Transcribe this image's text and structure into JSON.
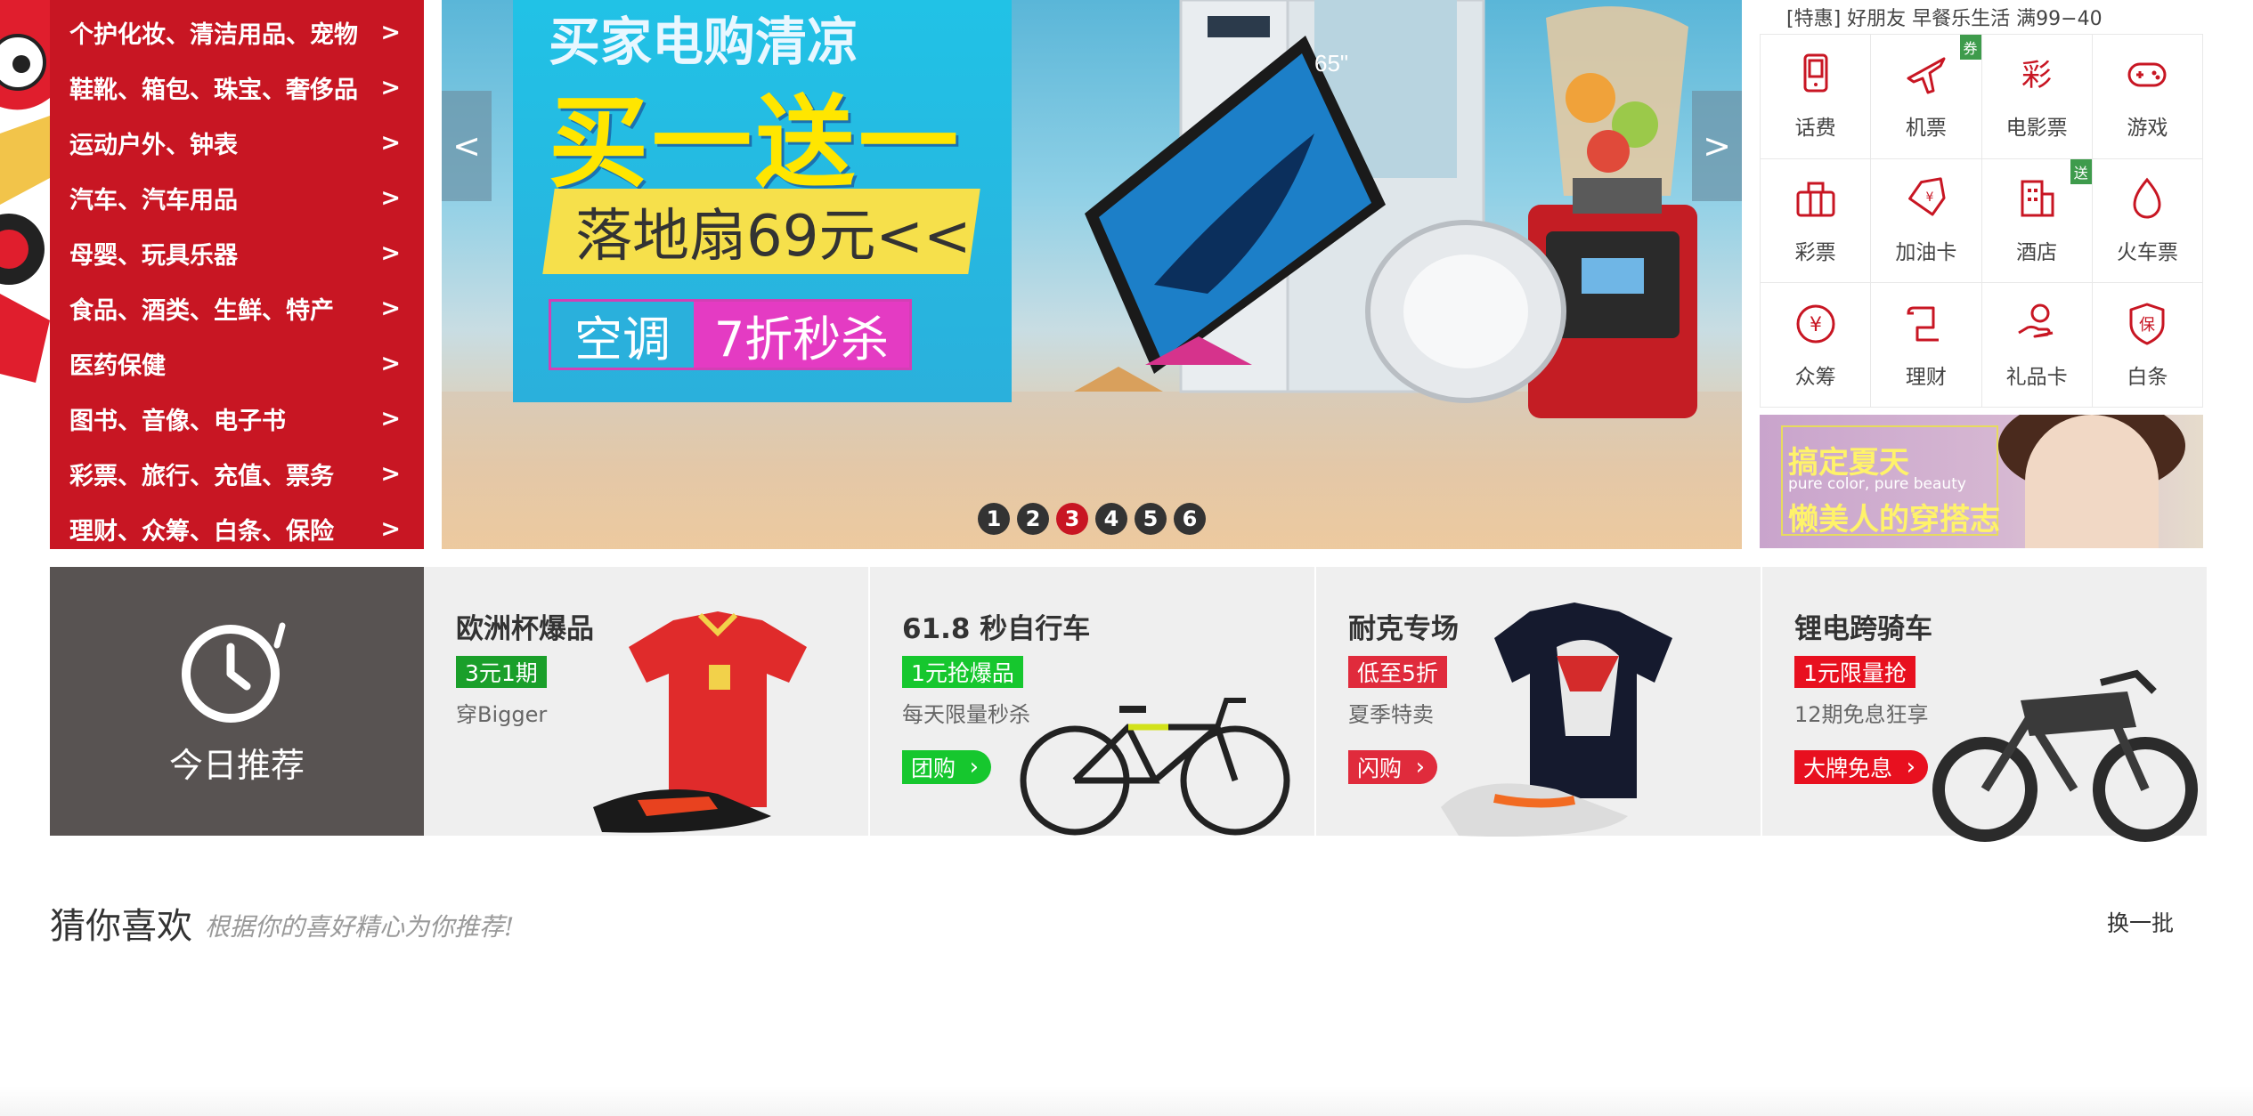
{
  "category_menu": {
    "items": [
      {
        "label": "个护化妆、清洁用品、宠物",
        "arrow": ">"
      },
      {
        "label": "鞋靴、箱包、珠宝、奢侈品",
        "arrow": ">"
      },
      {
        "label": "运动户外、钟表",
        "arrow": ">"
      },
      {
        "label": "汽车、汽车用品",
        "arrow": ">"
      },
      {
        "label": "母婴、玩具乐器",
        "arrow": ">"
      },
      {
        "label": "食品、酒类、生鲜、特产",
        "arrow": ">"
      },
      {
        "label": "医药保健",
        "arrow": ">"
      },
      {
        "label": "图书、音像、电子书",
        "arrow": ">"
      },
      {
        "label": "彩票、旅行、充值、票务",
        "arrow": ">"
      },
      {
        "label": "理财、众筹、白条、保险",
        "arrow": ">"
      }
    ]
  },
  "carousel": {
    "prev": "<",
    "next": ">",
    "banner": {
      "title": "买家电购清凉",
      "headline": "买一送一",
      "fan": "落地扇69元<<",
      "ac": "空调",
      "flash": "7折秒杀",
      "tv_size": "65\""
    },
    "dots": [
      "1",
      "2",
      "3",
      "4",
      "5",
      "6"
    ],
    "active_dot": 3
  },
  "notice": "[特惠] 好朋友 早餐乐生活 满99−40",
  "services": [
    {
      "label": "话费",
      "icon": "phone-icon",
      "tag": ""
    },
    {
      "label": "机票",
      "icon": "plane-icon",
      "tag": "券"
    },
    {
      "label": "电影票",
      "icon": "movie-icon",
      "tag": ""
    },
    {
      "label": "游戏",
      "icon": "gamepad-icon",
      "tag": ""
    },
    {
      "label": "彩票",
      "icon": "lottery-icon",
      "tag": ""
    },
    {
      "label": "加油卡",
      "icon": "fuel-card-icon",
      "tag": ""
    },
    {
      "label": "酒店",
      "icon": "hotel-icon",
      "tag": "送"
    },
    {
      "label": "火车票",
      "icon": "train-ticket-icon",
      "tag": ""
    },
    {
      "label": "众筹",
      "icon": "crowdfunding-icon",
      "tag": ""
    },
    {
      "label": "理财",
      "icon": "finance-icon",
      "tag": ""
    },
    {
      "label": "礼品卡",
      "icon": "gift-card-icon",
      "tag": ""
    },
    {
      "label": "白条",
      "icon": "insurance-icon",
      "tag": ""
    }
  ],
  "side_ad": {
    "line1": "搞定夏天",
    "line2": "pure color, pure beauty",
    "line3": "懒美人的穿搭志"
  },
  "today": {
    "label": "今日推荐"
  },
  "recs": [
    {
      "title": "欧洲杯爆品",
      "badge": "3元1期",
      "badge_color": "#1a9f2a",
      "sub": "穿Bigger",
      "btn": "",
      "btn_color": ""
    },
    {
      "title": "61.8 秒自行车",
      "badge": "1元抢爆品",
      "badge_color": "#16c72e",
      "sub": "每天限量秒杀",
      "btn": "团购",
      "btn_color": "#16c72e"
    },
    {
      "title": "耐克专场",
      "badge": "低至5折",
      "badge_color": "#e02b3c",
      "sub": "夏季特卖",
      "btn": "闪购",
      "btn_color": "#e02b3c"
    },
    {
      "title": "锂电跨骑车",
      "badge": "1元限量抢",
      "badge_color": "#e8101f",
      "sub": "12期免息狂享",
      "btn": "大牌免息",
      "btn_color": "#e8101f"
    }
  ],
  "guess": {
    "title": "猜你喜欢",
    "subtitle": "根据你的喜好精心为你推荐!",
    "refresh": "换一批"
  },
  "colors": {
    "brand_red": "#c81623",
    "today_bg": "#585352",
    "rec_bg": "#efefef"
  }
}
